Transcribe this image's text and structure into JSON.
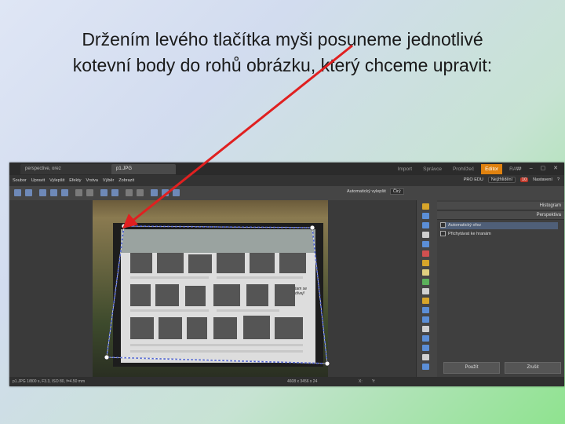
{
  "slide": {
    "title_line1": "Držením levého tlačítka myši posuneme jednotlivé",
    "title_line2": "kotevní body do rohů obrázku, který chceme upravit:"
  },
  "app": {
    "tabs": [
      "perspective, orez",
      "p1.JPG"
    ],
    "modes": [
      "Import",
      "Správce",
      "Prohlížeč",
      "Editor",
      "RAW"
    ],
    "active_mode": "Editor",
    "menu": [
      "Soubor",
      "Upravit",
      "Vylepšit",
      "Efekty",
      "Vrstva",
      "Výběr",
      "Zobrazit"
    ],
    "menu_right": {
      "pro": "PRO EDU",
      "recent": "Nejžhlidění",
      "settings": "Nastavení",
      "badge": "10"
    },
    "toolbar": {
      "auto_enhance": "Automatický vylepšit",
      "select_value": "Čirý"
    },
    "panel": {
      "histogram_tab": "Histogram",
      "perspective_tab": "Perspektiva",
      "option_auto": "Automatický ořez",
      "option_snap": "Přichytávat ke hranám",
      "apply_button": "Použít",
      "cancel_button": "Zrušit"
    },
    "status": {
      "file_info": "p1.JPG    1/800 s, F3.3, ISO 80, f=4.50 mm",
      "dimensions": "4608 x 3456 x 24",
      "zoom_a": "X:",
      "zoom_b": "Y:"
    },
    "image_note": "tam se dívej!"
  },
  "colors": {
    "accent": "#e0820f",
    "arrow": "#e02020",
    "anchor_line": "#4a5fd0"
  }
}
